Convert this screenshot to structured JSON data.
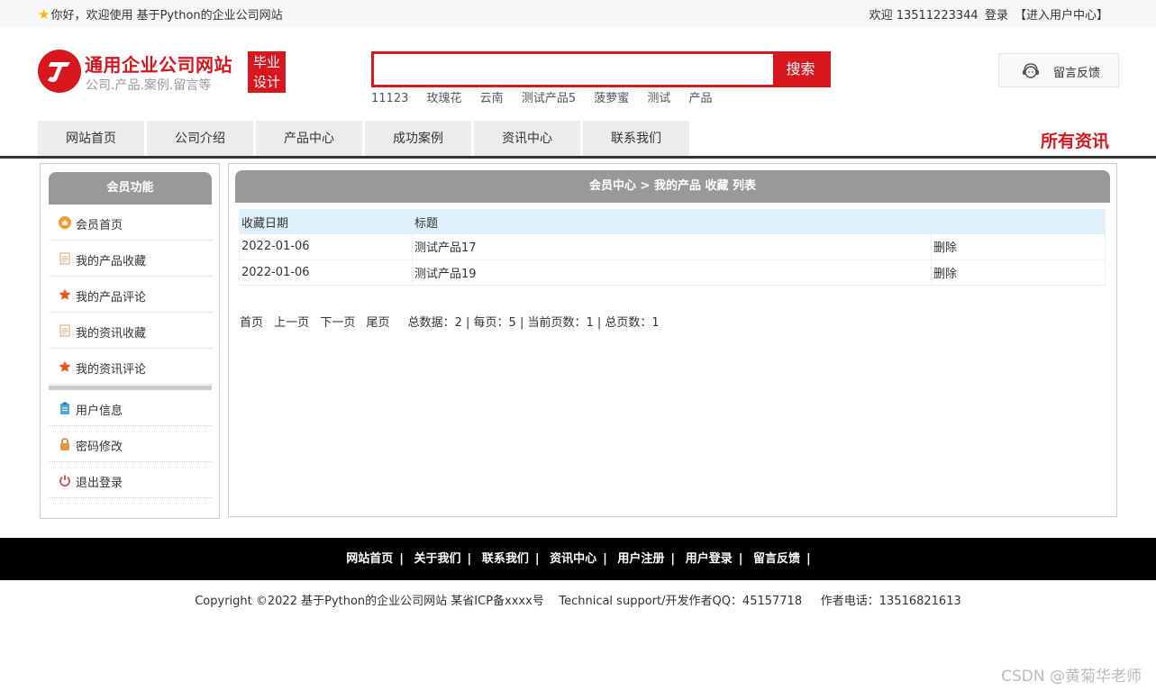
{
  "topbar": {
    "greeting": "你好，欢迎使用 基于Python的企业公司网站",
    "welcome": "欢迎 13511223344",
    "login": "登录",
    "user_center": "【进入用户中心】"
  },
  "logo": {
    "title": "通用企业公司网站",
    "subtitle": "公司.产品.案例.留言等",
    "badge_line1": "毕业",
    "badge_line2": "设计"
  },
  "search": {
    "value": "",
    "button": "搜索",
    "hotwords": [
      "11123",
      "玫瑰花",
      "云南",
      "测试产品5",
      "菠萝蜜",
      "测试",
      "产品"
    ]
  },
  "feedback": {
    "label": "留言反馈"
  },
  "nav": {
    "tabs": [
      "网站首页",
      "公司介绍",
      "产品中心",
      "成功案例",
      "资讯中心",
      "联系我们"
    ],
    "all_news": "所有资讯"
  },
  "sidebar": {
    "title": "会员功能",
    "items": [
      {
        "label": "会员首页",
        "icon": "home-icon"
      },
      {
        "label": "我的产品收藏",
        "icon": "document-icon"
      },
      {
        "label": "我的产品评论",
        "icon": "star-icon"
      },
      {
        "label": "我的资讯收藏",
        "icon": "document-icon"
      },
      {
        "label": "我的资讯评论",
        "icon": "star-icon"
      },
      {
        "label": "用户信息",
        "icon": "clipboard-icon"
      },
      {
        "label": "密码修改",
        "icon": "lock-icon"
      },
      {
        "label": "退出登录",
        "icon": "power-icon"
      }
    ]
  },
  "main": {
    "title": "会员中心 > 我的产品 收藏 列表",
    "columns": [
      "收藏日期",
      "标题",
      ""
    ],
    "rows": [
      {
        "date": "2022-01-06",
        "title": "测试产品17",
        "action": "删除"
      },
      {
        "date": "2022-01-06",
        "title": "测试产品19",
        "action": "删除"
      }
    ],
    "pager": {
      "first": "首页",
      "prev": "上一页",
      "next": "下一页",
      "last": "尾页",
      "stats": "总数据：2 | 每页：5 | 当前页数：1 | 总页数：1"
    }
  },
  "footer": {
    "links": [
      "网站首页",
      "关于我们",
      "联系我们",
      "资讯中心",
      "用户注册",
      "用户登录",
      "留言反馈"
    ],
    "copyright": "Copyright ©2022 基于Python的企业公司网站 某省ICP备xxxx号    Technical support/开发作者QQ：45157718     作者电话：13516821613"
  },
  "watermark": "CSDN @黄菊华老师",
  "colors": {
    "brand": "#d7161e",
    "header_gray": "#999999",
    "table_head": "#def0fb"
  }
}
